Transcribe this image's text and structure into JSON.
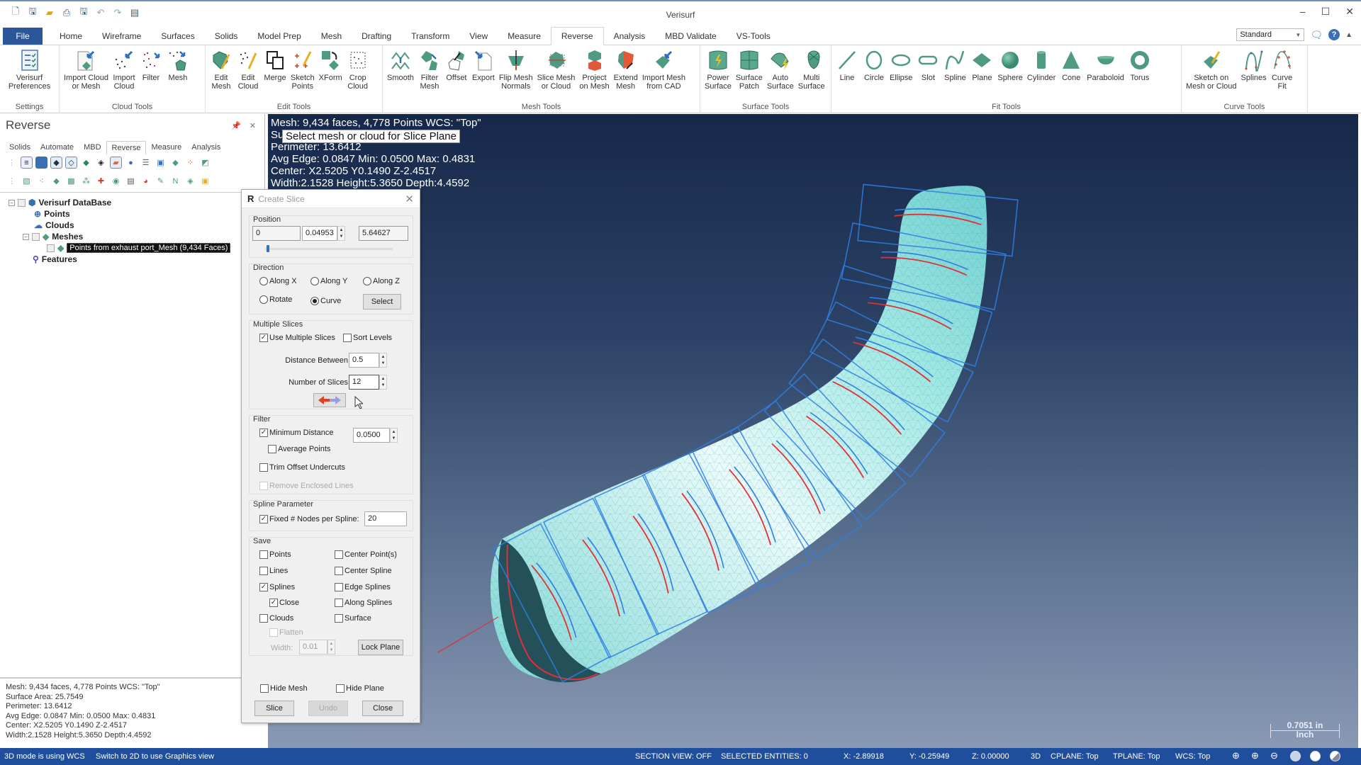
{
  "app": {
    "title": "Verisurf"
  },
  "qat": {
    "icons": [
      "new-icon",
      "save-icon",
      "open-icon",
      "print-icon",
      "save-as-icon",
      "undo-icon",
      "redo-icon",
      "customize-icon"
    ]
  },
  "window_controls": {
    "minimize": "–",
    "maximize": "☐",
    "close": "✕"
  },
  "tabs": [
    {
      "label": "File"
    },
    {
      "label": "Home"
    },
    {
      "label": "Wireframe"
    },
    {
      "label": "Surfaces"
    },
    {
      "label": "Solids"
    },
    {
      "label": "Model Prep"
    },
    {
      "label": "Mesh"
    },
    {
      "label": "Drafting"
    },
    {
      "label": "Transform"
    },
    {
      "label": "View"
    },
    {
      "label": "Measure"
    },
    {
      "label": "Reverse",
      "active": true
    },
    {
      "label": "Analysis"
    },
    {
      "label": "MBD Validate"
    },
    {
      "label": "VS-Tools"
    }
  ],
  "ribbon_right": {
    "workspace": "Standard"
  },
  "ribbon": {
    "groups": [
      {
        "label": "Settings",
        "buttons": [
          "Verisurf\nPreferences"
        ]
      },
      {
        "label": "Cloud Tools",
        "buttons": [
          "Import Cloud\nor Mesh",
          "Import\nCloud",
          "Filter",
          "Mesh"
        ]
      },
      {
        "label": "Edit Tools",
        "buttons": [
          "Edit\nMesh",
          "Edit\nCloud",
          "Merge",
          "Sketch\nPoints",
          "XForm",
          "Crop\nCloud"
        ]
      },
      {
        "label": "Mesh Tools",
        "buttons": [
          "Smooth",
          "Filter\nMesh",
          "Offset",
          "Export",
          "Flip Mesh\nNormals",
          "Slice Mesh\nor Cloud",
          "Project\non Mesh",
          "Extend\nMesh",
          "Import Mesh\nfrom CAD"
        ]
      },
      {
        "label": "Surface Tools",
        "buttons": [
          "Power\nSurface",
          "Surface\nPatch",
          "Auto\nSurface",
          "Multi\nSurface"
        ]
      },
      {
        "label": "Fit Tools",
        "buttons": [
          "Line",
          "Circle",
          "Ellipse",
          "Slot",
          "Spline",
          "Plane",
          "Sphere",
          "Cylinder",
          "Cone",
          "Paraboloid",
          "Torus"
        ]
      },
      {
        "label": "Curve Tools",
        "buttons": [
          "Sketch on\nMesh or Cloud",
          "Splines",
          "Curve\nFit"
        ]
      }
    ]
  },
  "left_panel": {
    "title": "Reverse",
    "tabs": [
      "Solids",
      "Automate",
      "MBD",
      "Reverse",
      "Measure",
      "Analysis"
    ],
    "active_tab": "Reverse",
    "tree": {
      "root": "Verisurf DataBase",
      "points": "Points",
      "clouds": "Clouds",
      "meshes": "Meshes",
      "mesh_item": "Points from exhaust port_Mesh (9,434 Faces)",
      "features": "Features"
    },
    "info": [
      "Mesh: 9,434 faces, 4,778 Points  WCS: \"Top\"",
      "Surface Area: 25.7549",
      "Perimeter: 13.6412",
      "Avg Edge: 0.0847 Min: 0.0500 Max: 0.4831",
      "Center: X2.5205 Y0.1490 Z-2.4517",
      "Width:2.1528 Height:5.3650 Depth:4.4592"
    ]
  },
  "viewport": {
    "info": [
      "Mesh: 9,434 faces, 4,778 Points  WCS: \"Top\"",
      "Surface Area: 25.7549",
      "Perimeter: 13.6412",
      "Avg Edge: 0.0847 Min: 0.0500 Max: 0.4831",
      "Center: X2.5205 Y0.1490 Z-2.4517",
      "Width:2.1528 Height:5.3650 Depth:4.4592"
    ],
    "tooltip": "Select mesh or cloud for Slice Plane",
    "scale": {
      "value": "0.7051 in",
      "unit": "Inch"
    },
    "colors": {
      "mesh": "#a8f0ec",
      "slice_plane": "#2f7fe0",
      "slice_curve": "#e0303a"
    }
  },
  "dialog": {
    "title": "Create Slice",
    "position": {
      "label": "Position",
      "min": "0",
      "value": "0.04953",
      "max": "5.64627",
      "slider_fraction": 0.009
    },
    "direction": {
      "label": "Direction",
      "options": [
        "Along X",
        "Along Y",
        "Along Z",
        "Rotate",
        "Curve"
      ],
      "selected": "Curve",
      "select_button": "Select"
    },
    "multiple": {
      "label": "Multiple Slices",
      "use_multiple": "Use Multiple Slices",
      "use_multiple_checked": true,
      "sort_levels": "Sort Levels",
      "sort_levels_checked": false,
      "distance_label": "Distance Between:",
      "distance": "0.5",
      "count_label": "Number of Slices:",
      "count": "12"
    },
    "filter": {
      "label": "Filter",
      "min_distance": "Minimum Distance",
      "min_distance_checked": true,
      "min_distance_value": "0.0500",
      "average_points": "Average Points",
      "trim_offset": "Trim Offset Undercuts",
      "remove_enclosed": "Remove Enclosed Lines"
    },
    "spline": {
      "label": "Spline Parameter",
      "fixed_nodes": "Fixed # Nodes per Spline:",
      "fixed_nodes_checked": true,
      "nodes": "20"
    },
    "save": {
      "label": "Save",
      "points": "Points",
      "lines": "Lines",
      "splines": "Splines",
      "close": "Close",
      "clouds": "Clouds",
      "flatten": "Flatten",
      "width_label": "Width:",
      "width": "0.01",
      "center_points": "Center Point(s)",
      "center_spline": "Center Spline",
      "edge_splines": "Edge Splines",
      "along_splines": "Along Splines",
      "surface": "Surface",
      "lock_plane": "Lock Plane"
    },
    "hide_mesh": "Hide Mesh",
    "hide_plane": "Hide Plane",
    "buttons": {
      "slice": "Slice",
      "undo": "Undo",
      "close": "Close"
    }
  },
  "status": {
    "left1": "3D mode is using WCS",
    "left2": "Switch to 2D to use Graphics view",
    "section": "SECTION VIEW: OFF",
    "selected": "SELECTED ENTITIES: 0",
    "x": "X:  -2.89918",
    "y": "Y:  -0.25949",
    "z": "Z:  0.00000",
    "mode": "3D",
    "cplane": "CPLANE: Top",
    "tplane": "TPLANE: Top",
    "wcs": "WCS: Top"
  }
}
